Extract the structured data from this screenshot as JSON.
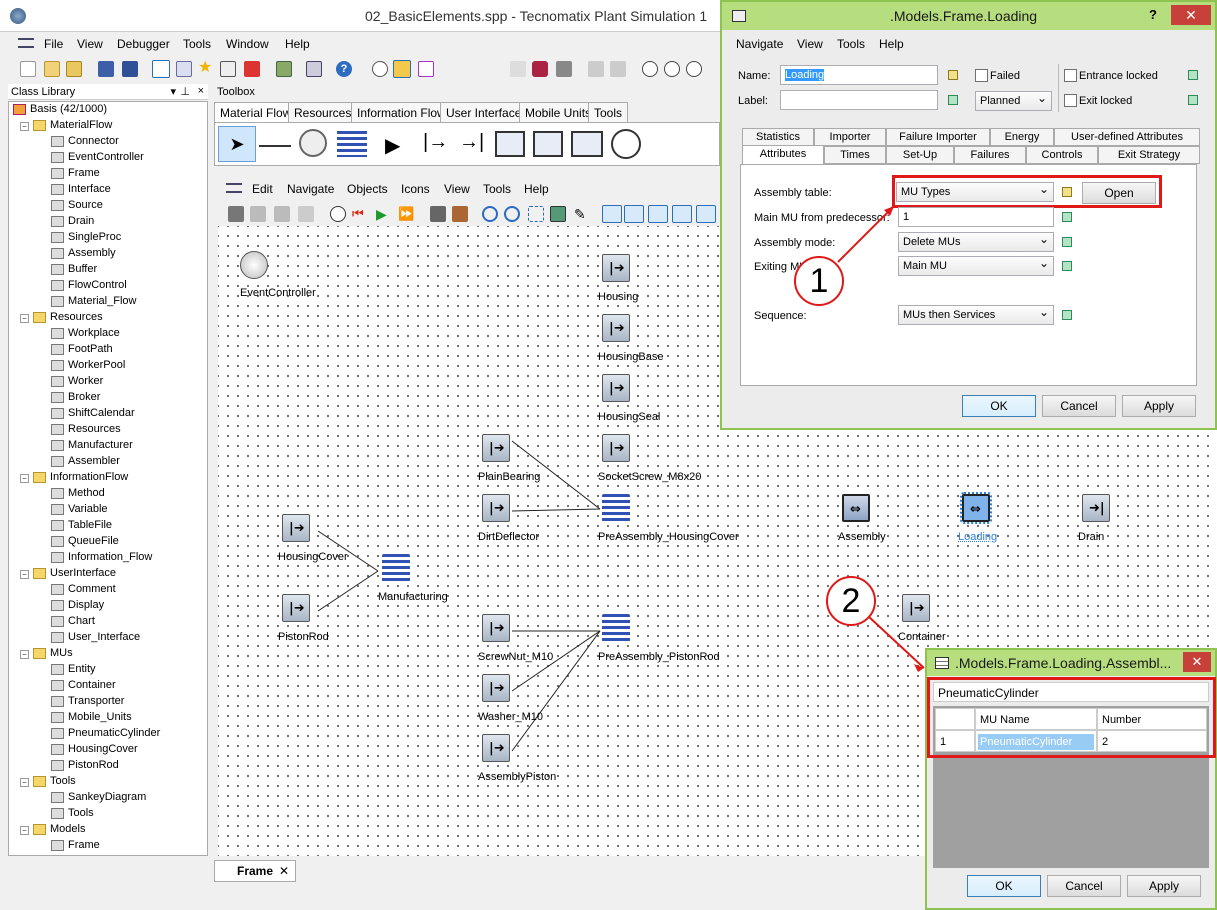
{
  "app": {
    "title": "02_BasicElements.spp - Tecnomatix Plant Simulation 1"
  },
  "menu": [
    "File",
    "View",
    "Debugger",
    "Tools",
    "Window",
    "Help"
  ],
  "class_library": {
    "title": "Class Library",
    "root": "Basis (42/1000)",
    "items": [
      {
        "label": "MaterialFlow",
        "folder": true,
        "level": 1
      },
      {
        "label": "Connector",
        "level": 2
      },
      {
        "label": "EventController",
        "level": 2
      },
      {
        "label": "Frame",
        "level": 2
      },
      {
        "label": "Interface",
        "level": 2
      },
      {
        "label": "Source",
        "level": 2
      },
      {
        "label": "Drain",
        "level": 2
      },
      {
        "label": "SingleProc",
        "level": 2
      },
      {
        "label": "Assembly",
        "level": 2
      },
      {
        "label": "Buffer",
        "level": 2
      },
      {
        "label": "FlowControl",
        "level": 2
      },
      {
        "label": "Material_Flow",
        "level": 2
      },
      {
        "label": "Resources",
        "folder": true,
        "level": 1
      },
      {
        "label": "Workplace",
        "level": 2
      },
      {
        "label": "FootPath",
        "level": 2
      },
      {
        "label": "WorkerPool",
        "level": 2
      },
      {
        "label": "Worker",
        "level": 2
      },
      {
        "label": "Broker",
        "level": 2
      },
      {
        "label": "ShiftCalendar",
        "level": 2
      },
      {
        "label": "Resources",
        "level": 2
      },
      {
        "label": "Manufacturer",
        "level": 2
      },
      {
        "label": "Assembler",
        "level": 2
      },
      {
        "label": "InformationFlow",
        "folder": true,
        "level": 1
      },
      {
        "label": "Method",
        "level": 2
      },
      {
        "label": "Variable",
        "level": 2
      },
      {
        "label": "TableFile",
        "level": 2
      },
      {
        "label": "QueueFile",
        "level": 2
      },
      {
        "label": "Information_Flow",
        "level": 2
      },
      {
        "label": "UserInterface",
        "folder": true,
        "level": 1
      },
      {
        "label": "Comment",
        "level": 2
      },
      {
        "label": "Display",
        "level": 2
      },
      {
        "label": "Chart",
        "level": 2
      },
      {
        "label": "User_Interface",
        "level": 2
      },
      {
        "label": "MUs",
        "folder": true,
        "level": 1
      },
      {
        "label": "Entity",
        "level": 2
      },
      {
        "label": "Container",
        "level": 2
      },
      {
        "label": "Transporter",
        "level": 2
      },
      {
        "label": "Mobile_Units",
        "level": 2
      },
      {
        "label": "PneumaticCylinder",
        "level": 2
      },
      {
        "label": "HousingCover",
        "level": 2
      },
      {
        "label": "PistonRod",
        "level": 2
      },
      {
        "label": "Tools",
        "folder": true,
        "level": 1
      },
      {
        "label": "SankeyDiagram",
        "level": 2
      },
      {
        "label": "Tools",
        "level": 2
      },
      {
        "label": "Models",
        "folder": true,
        "level": 1
      },
      {
        "label": "Frame",
        "level": 2
      }
    ]
  },
  "toolbox": {
    "title": "Toolbox",
    "tabs": [
      "Material Flow",
      "Resources",
      "Information Flow",
      "User Interface",
      "Mobile Units",
      "Tools"
    ]
  },
  "frame": {
    "menu": [
      "Edit",
      "Navigate",
      "Objects",
      "Icons",
      "View",
      "Tools",
      "Help"
    ],
    "tab": "Frame",
    "objects": [
      {
        "name": "EventController"
      },
      {
        "name": "Housing"
      },
      {
        "name": "HousingBase"
      },
      {
        "name": "HousingSeal"
      },
      {
        "name": "SocketScrew_M8x20"
      },
      {
        "name": "PlainBearing"
      },
      {
        "name": "DirtDeflector"
      },
      {
        "name": "PreAssembly_HousingCover"
      },
      {
        "name": "Assembly"
      },
      {
        "name": "Loading"
      },
      {
        "name": "Drain"
      },
      {
        "name": "HousingCover"
      },
      {
        "name": "Manufacturing"
      },
      {
        "name": "PistonRod"
      },
      {
        "name": "Container"
      },
      {
        "name": "ScrewNut_M10"
      },
      {
        "name": "PreAssembly_PistonRod"
      },
      {
        "name": "Washer_M10"
      },
      {
        "name": "AssemblyPiston"
      }
    ]
  },
  "dialog": {
    "title": ".Models.Frame.Loading",
    "help": "?",
    "menu": [
      "Navigate",
      "View",
      "Tools",
      "Help"
    ],
    "name_label": "Name:",
    "name_value": "Loading",
    "label_label": "Label:",
    "label_value": "",
    "failed": "Failed",
    "planned": "Planned",
    "entrance_locked": "Entrance locked",
    "exit_locked": "Exit locked",
    "tabs_row1": [
      "Statistics",
      "Importer",
      "Failure Importer",
      "Energy",
      "User-defined Attributes"
    ],
    "tabs_row2": [
      "Attributes",
      "Times",
      "Set-Up",
      "Failures",
      "Controls",
      "Exit Strategy"
    ],
    "assembly_table_label": "Assembly table:",
    "assembly_table_value": "MU Types",
    "open": "Open",
    "main_mu_label": "Main MU from predecessor:",
    "main_mu_value": "1",
    "assembly_mode_label": "Assembly mode:",
    "assembly_mode_value": "Delete MUs",
    "exiting_mu_label": "Exiting MU:",
    "exiting_mu_value": "Main MU",
    "sequence_label": "Sequence:",
    "sequence_value": "MUs then Services",
    "ok": "OK",
    "cancel": "Cancel",
    "apply": "Apply"
  },
  "table_dialog": {
    "title": ".Models.Frame.Loading.Assembl...",
    "header": "PneumaticCylinder",
    "columns": [
      "MU Name",
      "Number"
    ],
    "rows": [
      {
        "idx": "1",
        "mu": "PneumaticCylinder",
        "num": "2"
      }
    ],
    "ok": "OK",
    "cancel": "Cancel",
    "apply": "Apply"
  },
  "callouts": [
    "1",
    "2"
  ]
}
